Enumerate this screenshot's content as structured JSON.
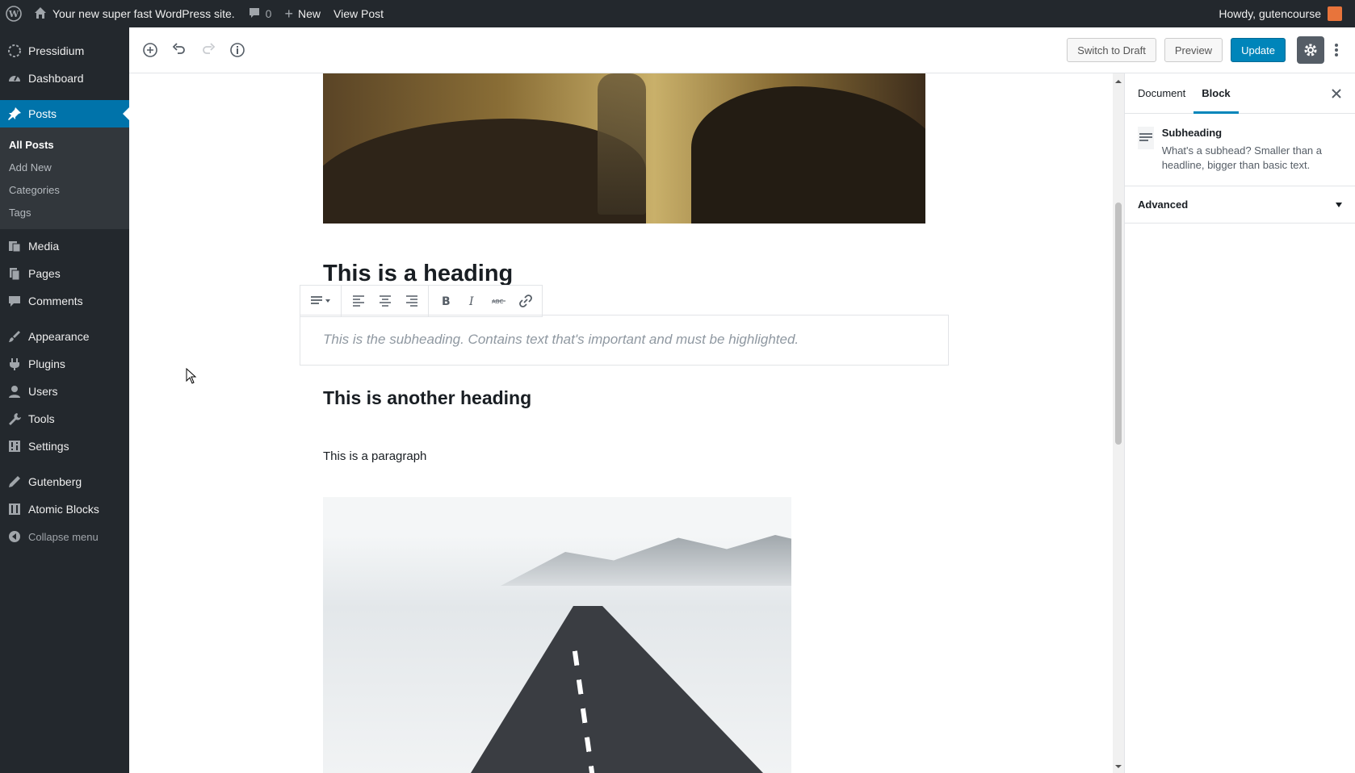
{
  "adminbar": {
    "site_name": "Your new super fast WordPress site.",
    "comments_count": "0",
    "new_label": "New",
    "view_post_label": "View Post",
    "greeting": "Howdy, gutencourse"
  },
  "sidebar": {
    "brand": "Pressidium",
    "dashboard": "Dashboard",
    "posts": "Posts",
    "sub": [
      "All Posts",
      "Add New",
      "Categories",
      "Tags"
    ],
    "media": "Media",
    "pages": "Pages",
    "comments": "Comments",
    "appearance": "Appearance",
    "plugins": "Plugins",
    "users": "Users",
    "tools": "Tools",
    "settings": "Settings",
    "gutenberg": "Gutenberg",
    "atomic_blocks": "Atomic Blocks",
    "collapse": "Collapse menu"
  },
  "header": {
    "switch_draft": "Switch to Draft",
    "preview": "Preview",
    "update": "Update"
  },
  "content": {
    "heading1": "This is a heading",
    "subheading": "This is the subheading. Contains text that's important and must be highlighted.",
    "heading2": "This is another heading",
    "paragraph": "This is a paragraph"
  },
  "settings": {
    "tab_document": "Document",
    "tab_block": "Block",
    "block_title": "Subheading",
    "block_desc": "What's a subhead? Smaller than a headline, bigger than basic text.",
    "advanced": "Advanced"
  },
  "colors": {
    "admin_dark": "#23282d",
    "accent": "#0073aa",
    "primary_button": "#0085ba"
  }
}
